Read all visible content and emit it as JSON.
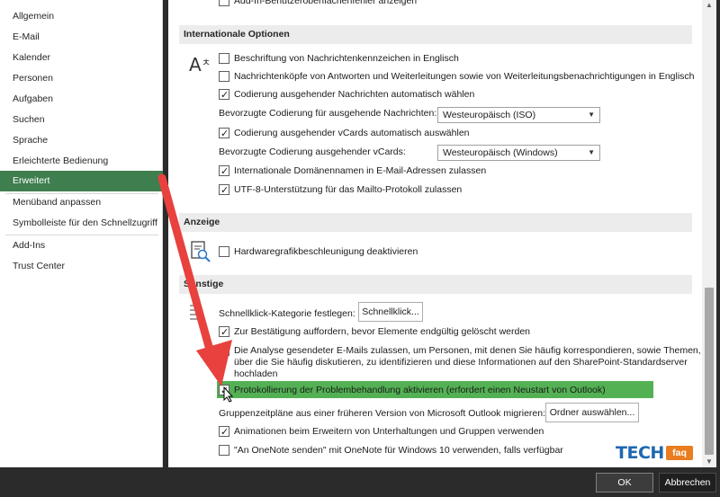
{
  "sidebar": {
    "items": [
      {
        "label": "Allgemein"
      },
      {
        "label": "E-Mail"
      },
      {
        "label": "Kalender"
      },
      {
        "label": "Personen"
      },
      {
        "label": "Aufgaben"
      },
      {
        "label": "Suchen"
      },
      {
        "label": "Sprache"
      },
      {
        "label": "Erleichterte Bedienung"
      },
      {
        "label": "Erweitert",
        "active": true
      },
      {
        "label": "Menüband anpassen"
      },
      {
        "label": "Symbolleiste für den Schnellzugriff"
      },
      {
        "label": "Add-Ins"
      },
      {
        "label": "Trust Center"
      }
    ]
  },
  "main": {
    "top_cut_row": "Add-In-Benutzeroberflächenfehler anzeigen",
    "international": {
      "header": "Internationale Optionen",
      "opt1": "Beschriftung von Nachrichtenkennzeichen in Englisch",
      "opt2": "Nachrichtenköpfe von Antworten und Weiterleitungen sowie von Weiterleitungsbenachrichtigungen in Englisch",
      "opt3": "Codierung ausgehender Nachrichten automatisch wählen",
      "enc_label": "Bevorzugte Codierung für ausgehende Nachrichten:",
      "enc_value": "Westeuropäisch (ISO)",
      "opt4": "Codierung ausgehender vCards automatisch auswählen",
      "vcard_label": "Bevorzugte Codierung ausgehender vCards:",
      "vcard_value": "Westeuropäisch (Windows)",
      "opt5": "Internationale Domänennamen in E-Mail-Adressen zulassen",
      "opt6": "UTF-8-Unterstützung für das Mailto-Protokoll zulassen"
    },
    "anzeige": {
      "header": "Anzeige",
      "opt1": "Hardwaregrafikbeschleunigung deaktivieren"
    },
    "sonstige": {
      "header": "Sonstige",
      "quick_label": "Schnellklick-Kategorie festlegen:",
      "quick_button": "Schnellklick...",
      "opt1": "Zur Bestätigung auffordern, bevor Elemente endgültig gelöscht werden",
      "opt2_line1": "Die Analyse gesendeter E-Mails zulassen, um Personen, mit denen Sie häufig korrespondieren, sowie Themen,",
      "opt2_line2": "über die Sie häufig diskutieren, zu identifizieren und diese Informationen auf den SharePoint-Standardserver",
      "opt2_line3": "hochladen",
      "opt3": "Protokollierung der Problembehandlung aktivieren (erfordert einen Neustart von Outlook)",
      "migrate_label": "Gruppenzeitpläne aus einer früheren Version von Microsoft Outlook migrieren:",
      "migrate_button": "Ordner auswählen...",
      "opt4": "Animationen beim Erweitern von Unterhaltungen und Gruppen verwenden",
      "opt5": "\"An OneNote senden\" mit OneNote für Windows 10 verwenden, falls verfügbar"
    }
  },
  "footer": {
    "ok": "OK",
    "cancel": "Abbrechen"
  },
  "watermark": {
    "tech": "TECH",
    "faq": "faq"
  },
  "colors": {
    "active_nav": "#3f7e4f",
    "highlight": "#53b153",
    "arrow": "#e8413e"
  }
}
